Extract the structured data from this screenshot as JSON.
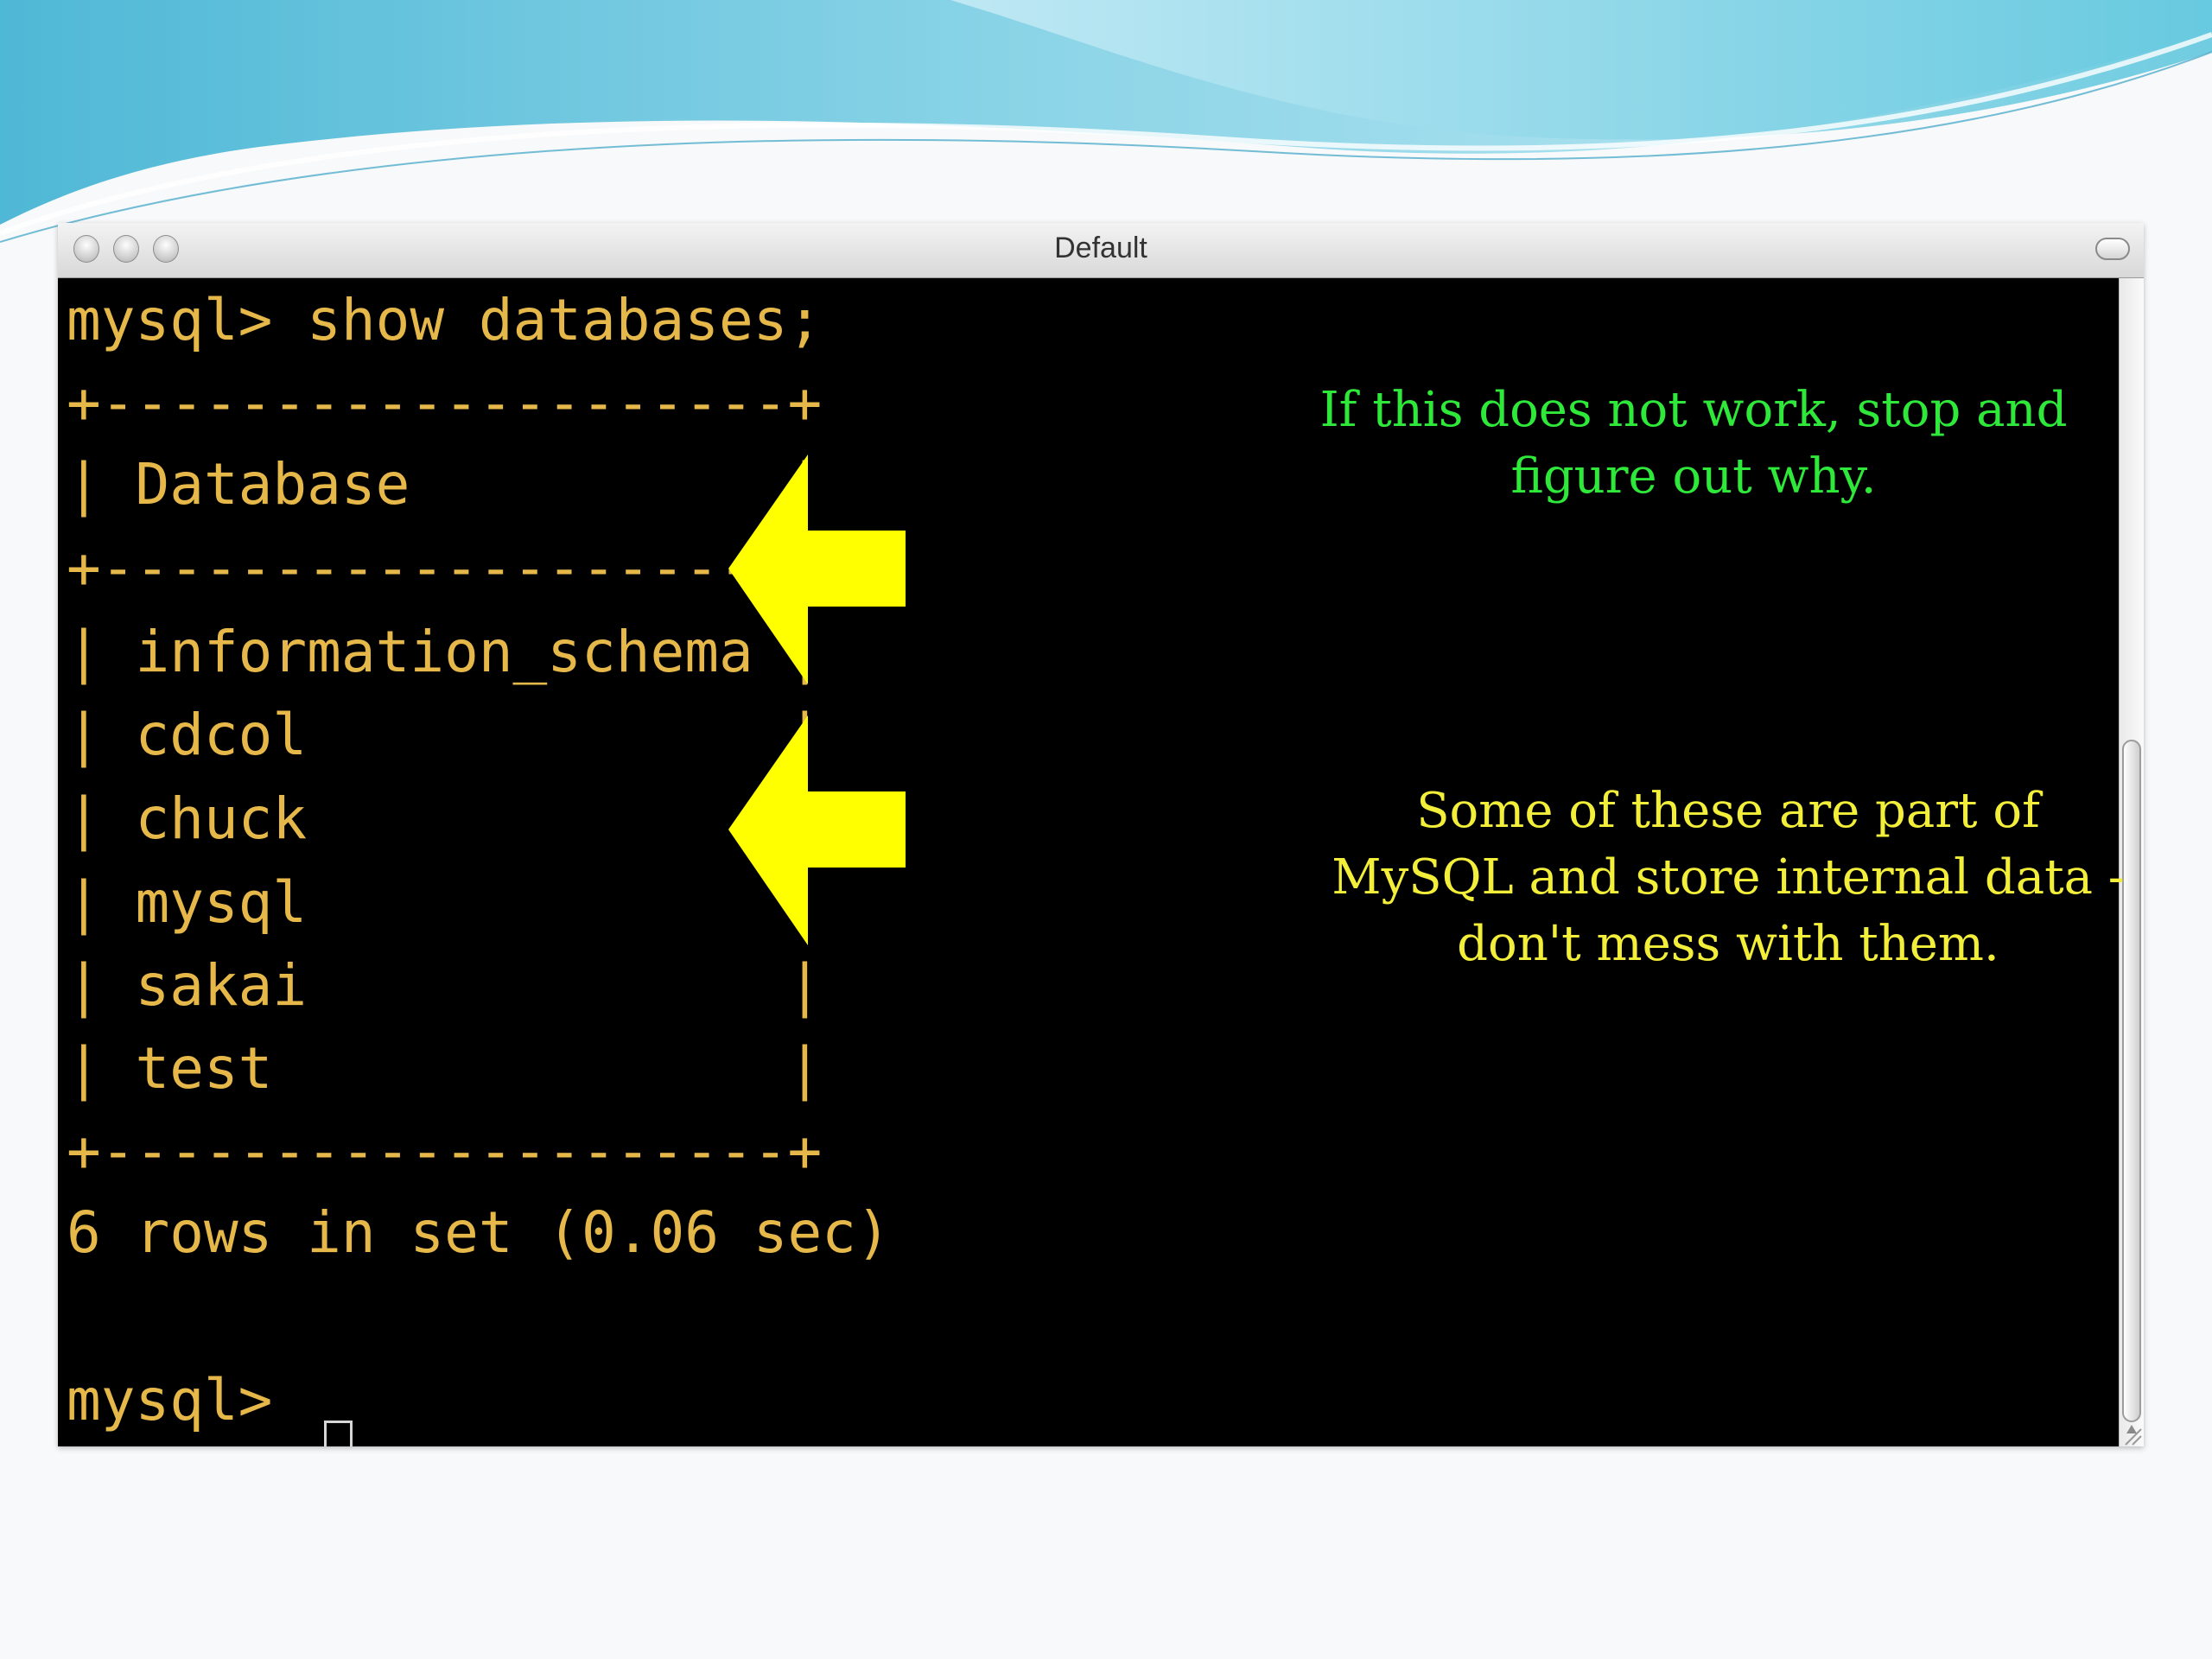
{
  "window": {
    "title": "Default",
    "buttons": [
      "close",
      "minimize",
      "zoom"
    ]
  },
  "terminal": {
    "lines": [
      "mysql> show databases;",
      "+--------------------+",
      "| Database           |",
      "+--------------------+",
      "| information_schema |",
      "| cdcol              |",
      "| chuck              |",
      "| mysql              |",
      "| sakai              |",
      "| test               |",
      "+--------------------+",
      "6 rows in set (0.06 sec)",
      "mysql> "
    ],
    "text_color": "#e6b84a",
    "background": "#000000"
  },
  "annotations": {
    "top_note": "If this does not work, stop and figure out why.",
    "bottom_note": "Some of these are part of MySQL and store internal data - don't mess with them.",
    "top_color": "#2ee83a",
    "bottom_color": "#f2ee3a",
    "arrow_color": "#ffff00"
  },
  "icons": [
    "close-button",
    "minimize-button",
    "zoom-button",
    "toolbar-toggle",
    "arrow-left-icon",
    "resize-grip-icon"
  ]
}
